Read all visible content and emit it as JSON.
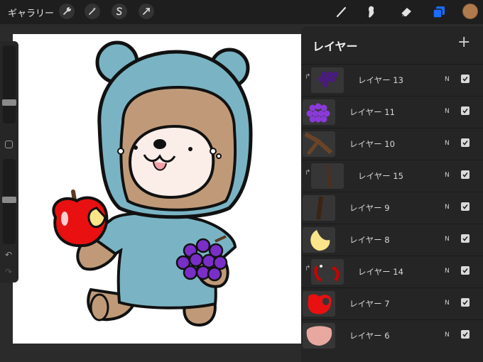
{
  "toolbar": {
    "gallery_label": "ギャラリー",
    "left_tools": [
      "wrench-icon",
      "magic-wand-icon",
      "selection-s-icon",
      "transform-arrow-icon"
    ],
    "right_tools": [
      "brush-icon",
      "smudge-icon",
      "eraser-icon",
      "layers-icon"
    ],
    "active_tool": "layers-icon",
    "color": "#b07a4c",
    "layers_accent": "#1a6cff"
  },
  "layers_panel": {
    "title": "レイヤー",
    "add_label": "+",
    "layers": [
      {
        "name": "レイヤー 13",
        "blend": "N",
        "clipped": true,
        "visible": true,
        "thumb": "grapes-dark"
      },
      {
        "name": "レイヤー 11",
        "blend": "N",
        "clipped": false,
        "visible": true,
        "thumb": "grapes"
      },
      {
        "name": "レイヤー 10",
        "blend": "N",
        "clipped": false,
        "visible": true,
        "thumb": "stem-brown"
      },
      {
        "name": "レイヤー 15",
        "blend": "N",
        "clipped": true,
        "visible": true,
        "thumb": "stem-shadow"
      },
      {
        "name": "レイヤー 9",
        "blend": "N",
        "clipped": false,
        "visible": true,
        "thumb": "stem-dark"
      },
      {
        "name": "レイヤー 8",
        "blend": "N",
        "clipped": false,
        "visible": true,
        "thumb": "bite-yellow"
      },
      {
        "name": "レイヤー 14",
        "blend": "N",
        "clipped": true,
        "visible": true,
        "thumb": "apple-shade"
      },
      {
        "name": "レイヤー 7",
        "blend": "N",
        "clipped": false,
        "visible": true,
        "thumb": "apple-red"
      },
      {
        "name": "レイヤー 6",
        "blend": "N",
        "clipped": false,
        "visible": true,
        "thumb": "skin-pink"
      }
    ]
  },
  "sidebar": {
    "brush_size": 0.24,
    "opacity": 0.45,
    "undo_glyph": "↶",
    "redo_glyph": "↷"
  }
}
